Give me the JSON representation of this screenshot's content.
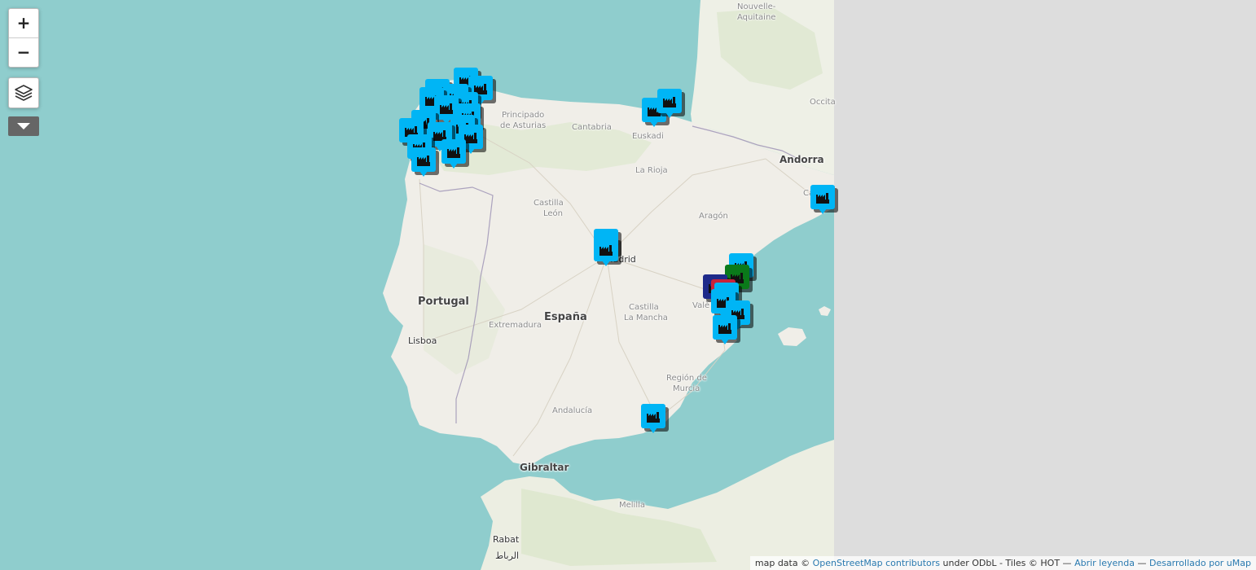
{
  "map": {
    "tile_provider_bg": "#dddddd",
    "sea_color": "#8fcdcd",
    "land_color": "#f0eee8",
    "labels": {
      "nouvelle_aquitaine_1": "Nouvelle-",
      "nouvelle_aquitaine_2": "Aquitaine",
      "principado_1": "Principado",
      "principado_2": "de Asturias",
      "cantabria": "Cantabria",
      "euskadi": "Euskadi",
      "andorra": "Andorra",
      "la_rioja": "La Rioja",
      "occitanie": "Occita",
      "castilla_leon_1": "Castilla",
      "castilla_leon_2": "León",
      "aragon": "Aragón",
      "catalunya": "Catalu",
      "madrid": "Madrid",
      "portugal": "Portugal",
      "espana": "España",
      "valencia": "Valè",
      "castilla_mancha_1": "Castilla",
      "castilla_mancha_2": "La Mancha",
      "extremadura": "Extremadura",
      "lisboa": "Lisboa",
      "region_murcia_1": "Región de",
      "region_murcia_2": "Murcia",
      "andalucia": "Andalucía",
      "gibraltar": "Gibraltar",
      "melilla": "Melilla",
      "rabat": "Rabat",
      "rabat_ar": "الرباط"
    }
  },
  "controls": {
    "zoom_in_label": "+",
    "zoom_out_label": "−",
    "layers_icon": "layers-icon",
    "more_icon": "caret-down-icon"
  },
  "markers": {
    "icon": "factory-icon",
    "color": "#00b5f5",
    "green_color": "#0a7a1a",
    "red_color": "#c8233b",
    "navy_color": "#1e2a8a"
  },
  "attribution": {
    "prefix": "map data © ",
    "osm_link": "OpenStreetMap contributors",
    "middle": " under ODbL - Tiles © HOT — ",
    "legend_link": "Abrir leyenda",
    "sep": " — ",
    "umap_link": "Desarrollado por uMap"
  }
}
